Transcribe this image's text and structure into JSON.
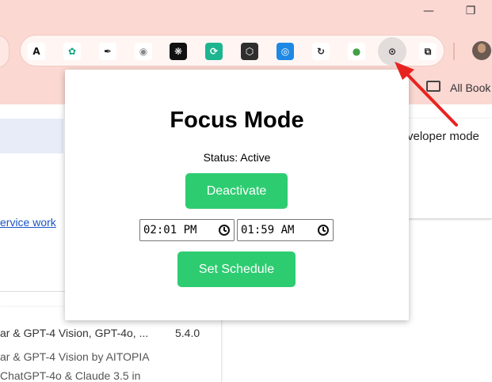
{
  "window": {
    "minimize_glyph": "—",
    "restore_glyph": "❐"
  },
  "toolbar": {
    "extensions": [
      {
        "icon": "angular-icon",
        "glyph": "A",
        "bg": "#ffffff",
        "fg": "#111111"
      },
      {
        "icon": "chatgpt-icon",
        "glyph": "✿",
        "bg": "#ffffff",
        "fg": "#10a37f"
      },
      {
        "icon": "eyedropper-icon",
        "glyph": "✒",
        "bg": "#ffffff",
        "fg": "#1a1a1a"
      },
      {
        "icon": "camera-icon",
        "glyph": "◉",
        "bg": "#ffffff",
        "fg": "#888888"
      },
      {
        "icon": "openai-icon",
        "glyph": "❋",
        "bg": "#111111",
        "fg": "#ffffff"
      },
      {
        "icon": "sync-arrows-icon",
        "glyph": "⟳",
        "bg": "#1db58f",
        "fg": "#ffffff"
      },
      {
        "icon": "perplexity-icon",
        "glyph": "⬡",
        "bg": "#2e2e2e",
        "fg": "#ffffff"
      },
      {
        "icon": "owl-icon",
        "glyph": "◎",
        "bg": "#1e88e5",
        "fg": "#ffffff"
      },
      {
        "icon": "refresh-icon",
        "glyph": "↻",
        "bg": "#ffffff",
        "fg": "#222222"
      },
      {
        "icon": "lightbulb-icon",
        "glyph": "●",
        "bg": "#ffffff",
        "fg": "#43a047"
      },
      {
        "icon": "focus-target-icon",
        "glyph": "⊙",
        "bg": "#e2dcda",
        "fg": "#222222"
      },
      {
        "icon": "puzzle-icon",
        "glyph": "⧉",
        "bg": "#ffffff",
        "fg": "#222222"
      }
    ]
  },
  "bookmarks": {
    "all_bookmarks_label": "All Book"
  },
  "background_page": {
    "developer_mode_label": "veloper mode",
    "service_worker_link": "ervice work",
    "extension_name": "ar & GPT-4 Vision, GPT-4o, ...",
    "extension_version": "5.4.0",
    "extension_desc_line1": "ar & GPT-4 Vision by AITOPIA",
    "extension_desc_line2": "ChatGPT-4o & Claude 3.5 in"
  },
  "popup": {
    "title": "Focus Mode",
    "status": "Status: Active",
    "deactivate_label": "Deactivate",
    "start_time": "02:01 PM",
    "end_time": "01:59 AM",
    "schedule_label": "Set Schedule"
  },
  "colors": {
    "accent_green": "#2ecc71",
    "chrome_bg": "#fbd8d2",
    "annotation_red": "#e8231f"
  }
}
